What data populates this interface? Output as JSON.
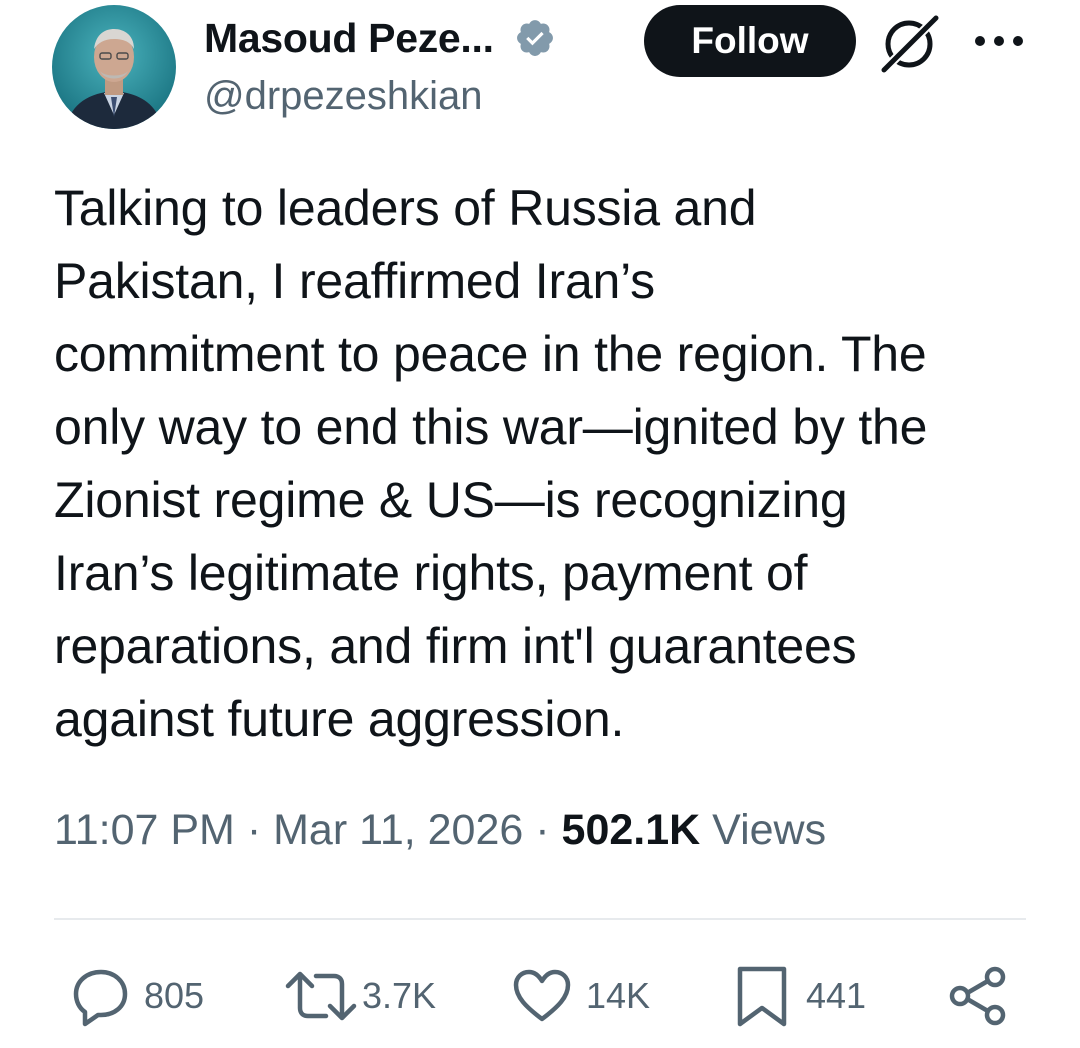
{
  "user": {
    "display_name": "Masoud Peze...",
    "handle": "@drpezeshkian",
    "avatar_icon": "profile-photo",
    "verified_icon": "verified-badge-icon",
    "verified_color": "#829aab"
  },
  "header": {
    "follow_label": "Follow",
    "grok_icon": "grok-icon",
    "more_icon": "more-options-icon"
  },
  "tweet": {
    "text": "Talking to leaders of Russia and\nPakistan, I reaffirmed Iran’s\ncommitment to peace in the region. The\nonly way to end this war—ignited by the\nZionist regime & US—is recognizing\nIran’s legitimate rights, payment of\nreparations, and firm int'l guarantees\nagainst future aggression."
  },
  "meta": {
    "time": "11:07 PM",
    "separator": "·",
    "date": "Mar 11, 2026",
    "views_count": "502.1K",
    "views_label": "Views"
  },
  "actions": {
    "replies": "805",
    "reposts": "3.7K",
    "likes": "14K",
    "bookmarks": "441"
  },
  "colors": {
    "text": "#0f1419",
    "secondary": "#536471",
    "button_bg": "#0f1419",
    "divider": "#e7eaed"
  }
}
